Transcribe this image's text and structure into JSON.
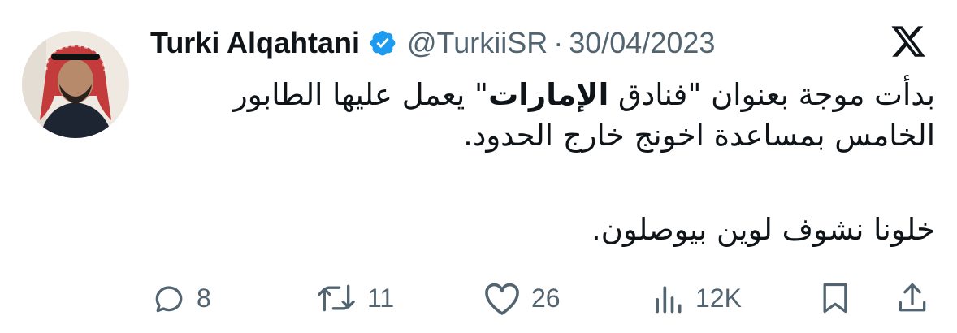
{
  "tweet": {
    "author_name": "Turki Alqahtani",
    "handle": "@TurkiiSR",
    "separator": "·",
    "date": "30/04/2023",
    "text_line1_a": "بدأت موجة بعنوان \"فنادق ",
    "text_line1_bold": "الإمارات",
    "text_line1_b": "\" يعمل عليها الطابور",
    "text_line2": "الخامس بمساعدة اخونج خارج الحدود.",
    "text_para2": "خلونا نشوف لوين بيوصلون."
  },
  "actions": {
    "replies": "8",
    "reposts": "11",
    "likes": "26",
    "views": "12K"
  },
  "colors": {
    "verified": "#1d9bf0",
    "text": "#0f1419",
    "secondary": "#536471"
  },
  "icons": [
    "verified-badge-icon",
    "x-logo-icon",
    "reply-icon",
    "repost-icon",
    "like-icon",
    "views-icon",
    "bookmark-icon",
    "share-icon"
  ]
}
